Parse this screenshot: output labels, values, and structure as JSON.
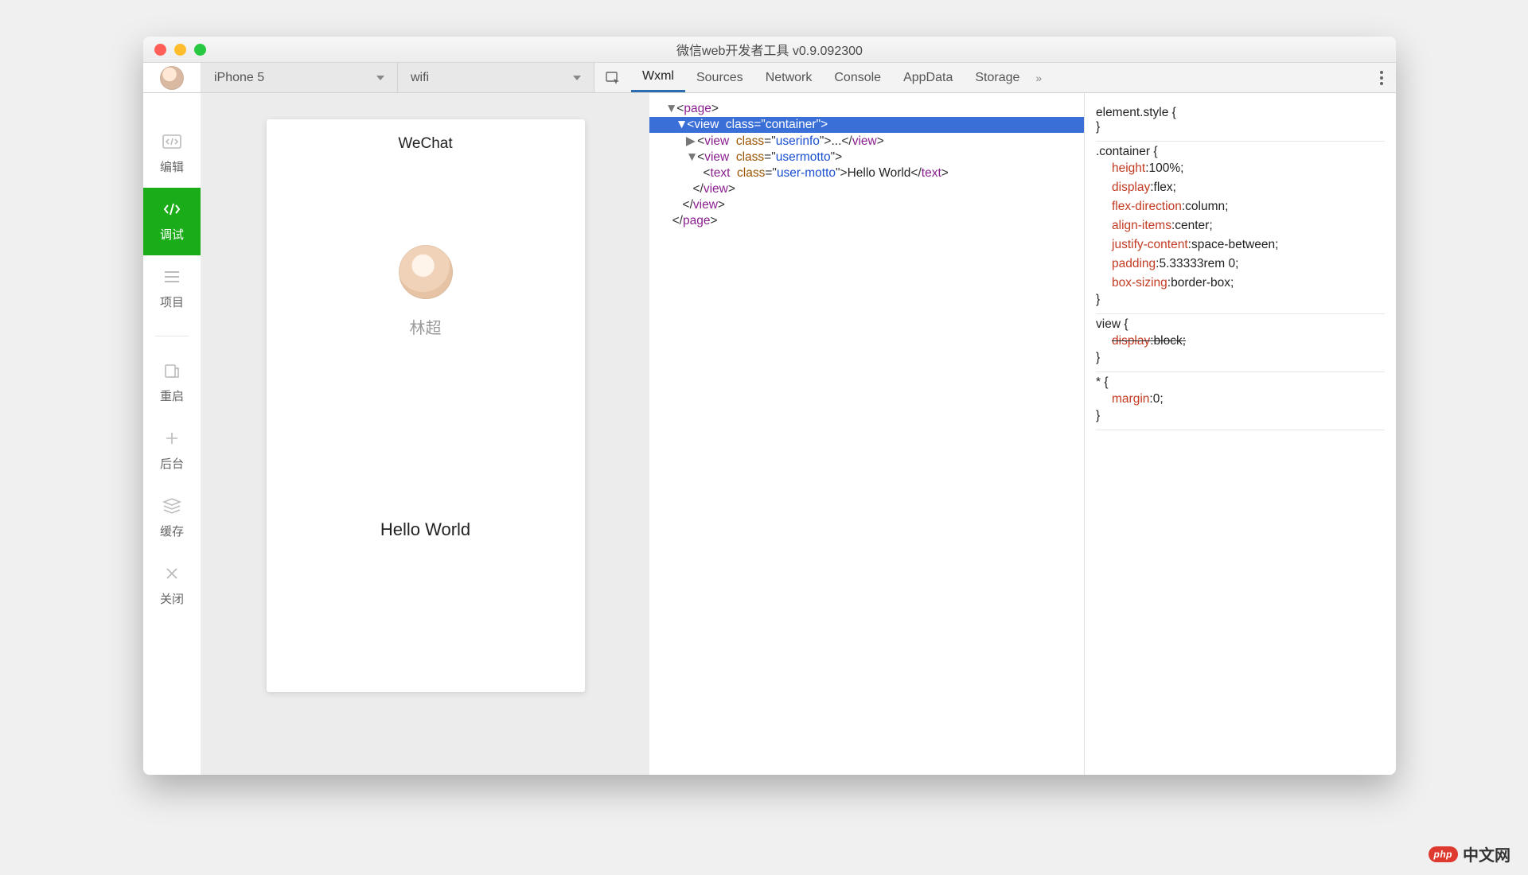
{
  "window": {
    "title": "微信web开发者工具 v0.9.092300"
  },
  "toolbar": {
    "device": "iPhone 5",
    "network": "wifi",
    "tabs": [
      "Wxml",
      "Sources",
      "Network",
      "Console",
      "AppData",
      "Storage"
    ],
    "overflow": "»"
  },
  "sidebar": {
    "items": [
      {
        "label": "编辑"
      },
      {
        "label": "调试"
      },
      {
        "label": "项目"
      },
      {
        "label": "重启"
      },
      {
        "label": "后台"
      },
      {
        "label": "缓存"
      },
      {
        "label": "关闭"
      }
    ]
  },
  "simulator": {
    "app_title": "WeChat",
    "username": "林超",
    "motto": "Hello World"
  },
  "dom": {
    "page_open": "page",
    "view_container": {
      "tag": "view",
      "attr": "class",
      "val": "container"
    },
    "view_userinfo": {
      "tag": "view",
      "attr": "class",
      "val": "userinfo",
      "ellipsis": "..."
    },
    "view_usermotto": {
      "tag": "view",
      "attr": "class",
      "val": "usermotto"
    },
    "text_motto": {
      "tag": "text",
      "attr": "class",
      "val": "user-motto",
      "text": "Hello World"
    },
    "close_text": "text",
    "close_view": "view",
    "close_page": "page"
  },
  "styles": {
    "r0": {
      "selector": "element.style {"
    },
    "r1": {
      "selector": ".container {",
      "props": [
        {
          "n": "height",
          "v": ":100%;"
        },
        {
          "n": "display",
          "v": ":flex;"
        },
        {
          "n": "flex-direction",
          "v": ":column;"
        },
        {
          "n": "align-items",
          "v": ":center;"
        },
        {
          "n": "justify-content",
          "v": ":space-between;"
        },
        {
          "n": "padding",
          "v": ":5.33333rem 0;"
        },
        {
          "n": "box-sizing",
          "v": ":border-box;"
        }
      ]
    },
    "r2": {
      "selector": "view {",
      "props": [
        {
          "n": "display",
          "v": ":block;",
          "strike": true
        }
      ]
    },
    "r3": {
      "selector": "* {",
      "props": [
        {
          "n": "margin",
          "v": ":0;"
        }
      ]
    },
    "brace_close": "}"
  },
  "watermark": {
    "badge": "php",
    "text": "中文网"
  }
}
